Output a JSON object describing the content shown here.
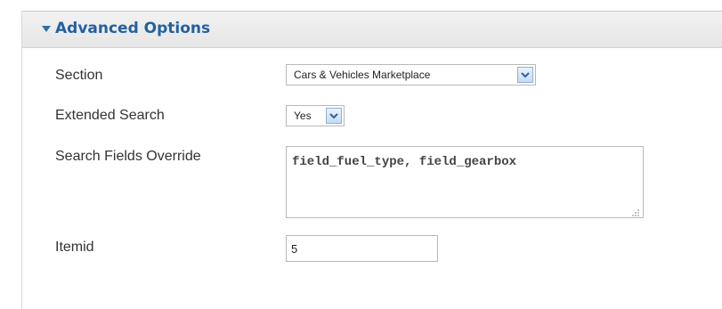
{
  "panel": {
    "title": "Advanced Options",
    "toggle_icon": "triangle-down-icon",
    "accent_color": "#24609f"
  },
  "fields": {
    "section": {
      "label": "Section",
      "value": "Cars & Vehicles Marketplace",
      "icon": "chevron-down-icon"
    },
    "extended_search": {
      "label": "Extended Search",
      "value": "Yes",
      "icon": "chevron-down-icon"
    },
    "search_fields_override": {
      "label": "Search Fields Override",
      "value": "field_fuel_type, field_gearbox",
      "icon": "resize-grip-icon"
    },
    "itemid": {
      "label": "Itemid",
      "value": "5"
    }
  }
}
